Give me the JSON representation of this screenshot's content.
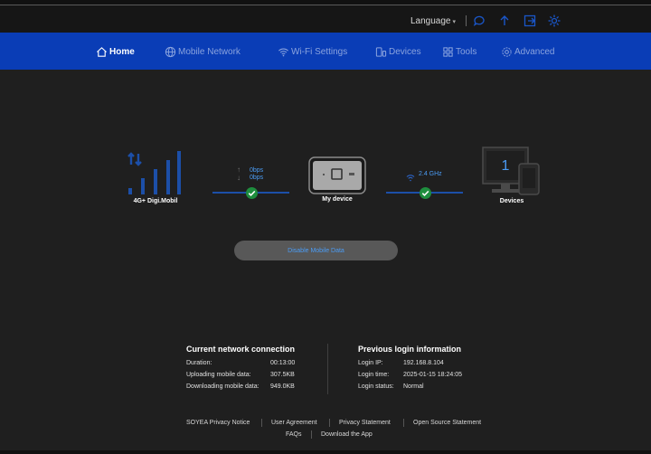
{
  "topbar": {
    "language_label": "Language",
    "icons": [
      "chat-icon",
      "upload-icon",
      "logout-icon",
      "settings-icon"
    ]
  },
  "nav": {
    "items": [
      {
        "label": "Home",
        "icon": "home-icon",
        "active": true
      },
      {
        "label": "Mobile Network",
        "icon": "globe-icon",
        "active": false
      },
      {
        "label": "Wi-Fi Settings",
        "icon": "wifi-icon",
        "active": false
      },
      {
        "label": "Devices",
        "icon": "devices-icon",
        "active": false
      },
      {
        "label": "Tools",
        "icon": "tools-icon",
        "active": false
      },
      {
        "label": "Advanced",
        "icon": "gear-icon",
        "active": false
      }
    ]
  },
  "topology": {
    "network_label": "4G+  Digi.Mobil",
    "upload_rate": "0bps",
    "download_rate": "0bps",
    "device_label": "My device",
    "wifi_band": "2.4 GHz",
    "devices_count": "1",
    "devices_label": "Devices"
  },
  "disable_button_label": "Disable Mobile Data",
  "current_connection": {
    "title": "Current network connection",
    "rows": [
      {
        "label": "Duration:",
        "value": "00:13:00"
      },
      {
        "label": "Uploading mobile data:",
        "value": "307.5KB"
      },
      {
        "label": "Downloading mobile data:",
        "value": "949.0KB"
      }
    ]
  },
  "previous_login": {
    "title": "Previous login information",
    "rows": [
      {
        "label": "Login IP:",
        "value": "192.168.8.104"
      },
      {
        "label": "Login time:",
        "value": "2025-01-15 18:24:05"
      },
      {
        "label": "Login status:",
        "value": "Normal"
      }
    ]
  },
  "footer": {
    "links_row1": [
      "SOYEA Privacy Notice",
      "User Agreement",
      "Privacy Statement",
      "Open Source Statement"
    ],
    "links_row2": [
      "FAQs",
      "Download the App"
    ]
  },
  "colors": {
    "nav_bg": "#0a3db6",
    "accent_blue": "#4b9cf5",
    "check_green": "#1e8e3e",
    "page_bg": "#1f1f1f"
  }
}
